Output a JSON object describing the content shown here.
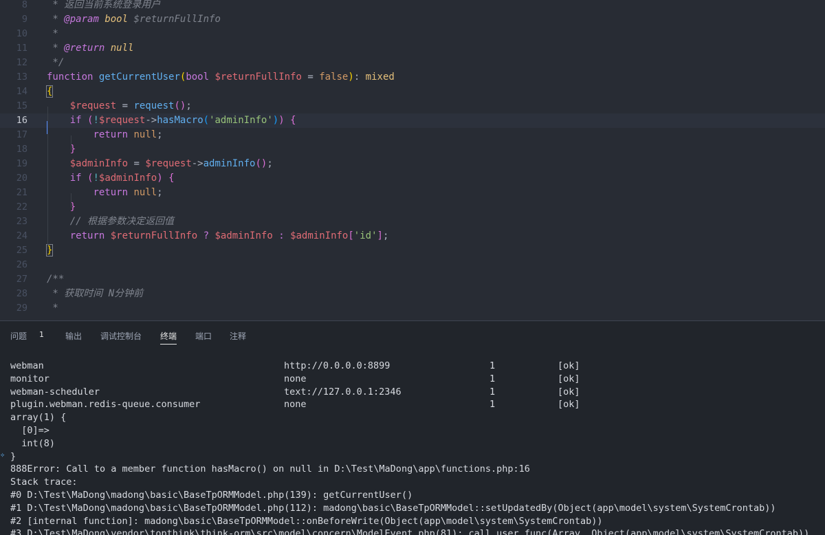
{
  "editor": {
    "lines": [
      {
        "n": "8",
        "tokens": [
          {
            "t": " * ",
            "c": "t-cm"
          },
          {
            "t": "返回当前系统登录用户",
            "c": "t-cm"
          }
        ]
      },
      {
        "n": "9",
        "tokens": [
          {
            "t": " * ",
            "c": "t-cm"
          },
          {
            "t": "@param",
            "c": "t-cmtag"
          },
          {
            "t": " ",
            "c": "t-cm"
          },
          {
            "t": "bool",
            "c": "t-cmtype"
          },
          {
            "t": " ",
            "c": "t-cm"
          },
          {
            "t": "$returnFullInfo",
            "c": "t-cm"
          }
        ]
      },
      {
        "n": "10",
        "tokens": [
          {
            "t": " *",
            "c": "t-cm"
          }
        ]
      },
      {
        "n": "11",
        "tokens": [
          {
            "t": " * ",
            "c": "t-cm"
          },
          {
            "t": "@return",
            "c": "t-cmtag"
          },
          {
            "t": " ",
            "c": "t-cm"
          },
          {
            "t": "null",
            "c": "t-cmtype"
          }
        ]
      },
      {
        "n": "12",
        "tokens": [
          {
            "t": " */",
            "c": "t-cm"
          }
        ]
      },
      {
        "n": "13",
        "tokens": [
          {
            "t": "function",
            "c": "t-kw"
          },
          {
            "t": " ",
            "c": "t-plain"
          },
          {
            "t": "getCurrentUser",
            "c": "t-fn"
          },
          {
            "t": "(",
            "c": "t-br1"
          },
          {
            "t": "bool",
            "c": "t-kw"
          },
          {
            "t": " ",
            "c": "t-plain"
          },
          {
            "t": "$returnFullInfo",
            "c": "t-var"
          },
          {
            "t": " = ",
            "c": "t-plain"
          },
          {
            "t": "false",
            "c": "t-const"
          },
          {
            "t": ")",
            "c": "t-br1"
          },
          {
            "t": ": ",
            "c": "t-plain"
          },
          {
            "t": "mixed",
            "c": "t-type"
          }
        ]
      },
      {
        "n": "14",
        "tokens": [
          {
            "t": "{",
            "c": "t-br1 bracket-box"
          }
        ]
      },
      {
        "n": "15",
        "tokens": [
          {
            "t": "    ",
            "c": "t-plain"
          },
          {
            "t": "$request",
            "c": "t-var"
          },
          {
            "t": " = ",
            "c": "t-plain"
          },
          {
            "t": "request",
            "c": "t-fn"
          },
          {
            "t": "()",
            "c": "t-br2"
          },
          {
            "t": ";",
            "c": "t-plain"
          }
        ]
      },
      {
        "n": "16",
        "tokens": [
          {
            "t": "    ",
            "c": "t-plain"
          },
          {
            "t": "if",
            "c": "t-kw"
          },
          {
            "t": " ",
            "c": "t-plain"
          },
          {
            "t": "(",
            "c": "t-br2"
          },
          {
            "t": "!",
            "c": "t-op"
          },
          {
            "t": "$request",
            "c": "t-var"
          },
          {
            "t": "->",
            "c": "t-plain"
          },
          {
            "t": "hasMacro",
            "c": "t-fn"
          },
          {
            "t": "(",
            "c": "t-br3"
          },
          {
            "t": "'adminInfo'",
            "c": "t-str"
          },
          {
            "t": ")",
            "c": "t-br3"
          },
          {
            "t": ")",
            "c": "t-br2"
          },
          {
            "t": " ",
            "c": "t-plain"
          },
          {
            "t": "{",
            "c": "t-br2"
          }
        ]
      },
      {
        "n": "17",
        "tokens": [
          {
            "t": "        ",
            "c": "t-plain"
          },
          {
            "t": "return",
            "c": "t-kw"
          },
          {
            "t": " ",
            "c": "t-plain"
          },
          {
            "t": "null",
            "c": "t-const"
          },
          {
            "t": ";",
            "c": "t-plain"
          }
        ]
      },
      {
        "n": "18",
        "tokens": [
          {
            "t": "    ",
            "c": "t-plain"
          },
          {
            "t": "}",
            "c": "t-br2"
          }
        ]
      },
      {
        "n": "19",
        "tokens": [
          {
            "t": "    ",
            "c": "t-plain"
          },
          {
            "t": "$adminInfo",
            "c": "t-var"
          },
          {
            "t": " = ",
            "c": "t-plain"
          },
          {
            "t": "$request",
            "c": "t-var"
          },
          {
            "t": "->",
            "c": "t-plain"
          },
          {
            "t": "adminInfo",
            "c": "t-fn"
          },
          {
            "t": "()",
            "c": "t-br2"
          },
          {
            "t": ";",
            "c": "t-plain"
          }
        ]
      },
      {
        "n": "20",
        "tokens": [
          {
            "t": "    ",
            "c": "t-plain"
          },
          {
            "t": "if",
            "c": "t-kw"
          },
          {
            "t": " ",
            "c": "t-plain"
          },
          {
            "t": "(",
            "c": "t-br2"
          },
          {
            "t": "!",
            "c": "t-op"
          },
          {
            "t": "$adminInfo",
            "c": "t-var"
          },
          {
            "t": ")",
            "c": "t-br2"
          },
          {
            "t": " ",
            "c": "t-plain"
          },
          {
            "t": "{",
            "c": "t-br2"
          }
        ]
      },
      {
        "n": "21",
        "tokens": [
          {
            "t": "        ",
            "c": "t-plain"
          },
          {
            "t": "return",
            "c": "t-kw"
          },
          {
            "t": " ",
            "c": "t-plain"
          },
          {
            "t": "null",
            "c": "t-const"
          },
          {
            "t": ";",
            "c": "t-plain"
          }
        ]
      },
      {
        "n": "22",
        "tokens": [
          {
            "t": "    ",
            "c": "t-plain"
          },
          {
            "t": "}",
            "c": "t-br2"
          }
        ]
      },
      {
        "n": "23",
        "tokens": [
          {
            "t": "    ",
            "c": "t-plain"
          },
          {
            "t": "// 根据参数决定返回值",
            "c": "t-cm"
          }
        ]
      },
      {
        "n": "24",
        "tokens": [
          {
            "t": "    ",
            "c": "t-plain"
          },
          {
            "t": "return",
            "c": "t-kw"
          },
          {
            "t": " ",
            "c": "t-plain"
          },
          {
            "t": "$returnFullInfo",
            "c": "t-var"
          },
          {
            "t": " ? ",
            "c": "t-kw"
          },
          {
            "t": "$adminInfo",
            "c": "t-var"
          },
          {
            "t": " : ",
            "c": "t-kw"
          },
          {
            "t": "$adminInfo",
            "c": "t-var"
          },
          {
            "t": "[",
            "c": "t-br2"
          },
          {
            "t": "'id'",
            "c": "t-str"
          },
          {
            "t": "]",
            "c": "t-br2"
          },
          {
            "t": ";",
            "c": "t-plain"
          }
        ]
      },
      {
        "n": "25",
        "tokens": [
          {
            "t": "}",
            "c": "t-br1 bracket-box"
          }
        ]
      },
      {
        "n": "26",
        "tokens": []
      },
      {
        "n": "27",
        "tokens": [
          {
            "t": "/**",
            "c": "t-cm"
          }
        ]
      },
      {
        "n": "28",
        "tokens": [
          {
            "t": " * ",
            "c": "t-cm"
          },
          {
            "t": "获取时间 N分钟前",
            "c": "t-cm"
          }
        ]
      },
      {
        "n": "29",
        "tokens": [
          {
            "t": " *",
            "c": "t-cm"
          }
        ]
      }
    ],
    "current_line": "16"
  },
  "panel": {
    "tabs": [
      {
        "id": "problems",
        "label": "问题"
      },
      {
        "id": "output",
        "label": "输出"
      },
      {
        "id": "debug",
        "label": "调试控制台"
      },
      {
        "id": "terminal",
        "label": "终端"
      },
      {
        "id": "ports",
        "label": "端口"
      },
      {
        "id": "comments",
        "label": "注释"
      }
    ],
    "active_tab": "terminal",
    "problems_count": "1"
  },
  "terminal": {
    "process_rows": [
      {
        "name": "webman",
        "listen": "http://0.0.0.0:8899",
        "count": "1",
        "status": "[ok]"
      },
      {
        "name": "monitor",
        "listen": "none",
        "count": "1",
        "status": "[ok]"
      },
      {
        "name": "webman-scheduler",
        "listen": "text://127.0.0.1:2346",
        "count": "1",
        "status": "[ok]"
      },
      {
        "name": "plugin.webman.redis-queue.consumer",
        "listen": "none",
        "count": "1",
        "status": "[ok]"
      }
    ],
    "output_lines": [
      "array(1) {",
      "  [0]=>",
      "  int(8)",
      "}",
      "888Error: Call to a member function hasMacro() on null in D:\\Test\\MaDong\\app\\functions.php:16",
      "Stack trace:",
      "#0 D:\\Test\\MaDong\\madong\\basic\\BaseTpORMModel.php(139): getCurrentUser()",
      "#1 D:\\Test\\MaDong\\madong\\basic\\BaseTpORMModel.php(112): madong\\basic\\BaseTpORMModel::setUpdatedBy(Object(app\\model\\system\\SystemCrontab))",
      "#2 [internal function]: madong\\basic\\BaseTpORMModel::onBeforeWrite(Object(app\\model\\system\\SystemCrontab))",
      "#3 D:\\Test\\MaDong\\vendor\\topthink\\think-orm\\src\\model\\concern\\ModelEvent.php(81): call_user_func(Array, Object(app\\model\\system\\SystemCrontab))"
    ]
  }
}
